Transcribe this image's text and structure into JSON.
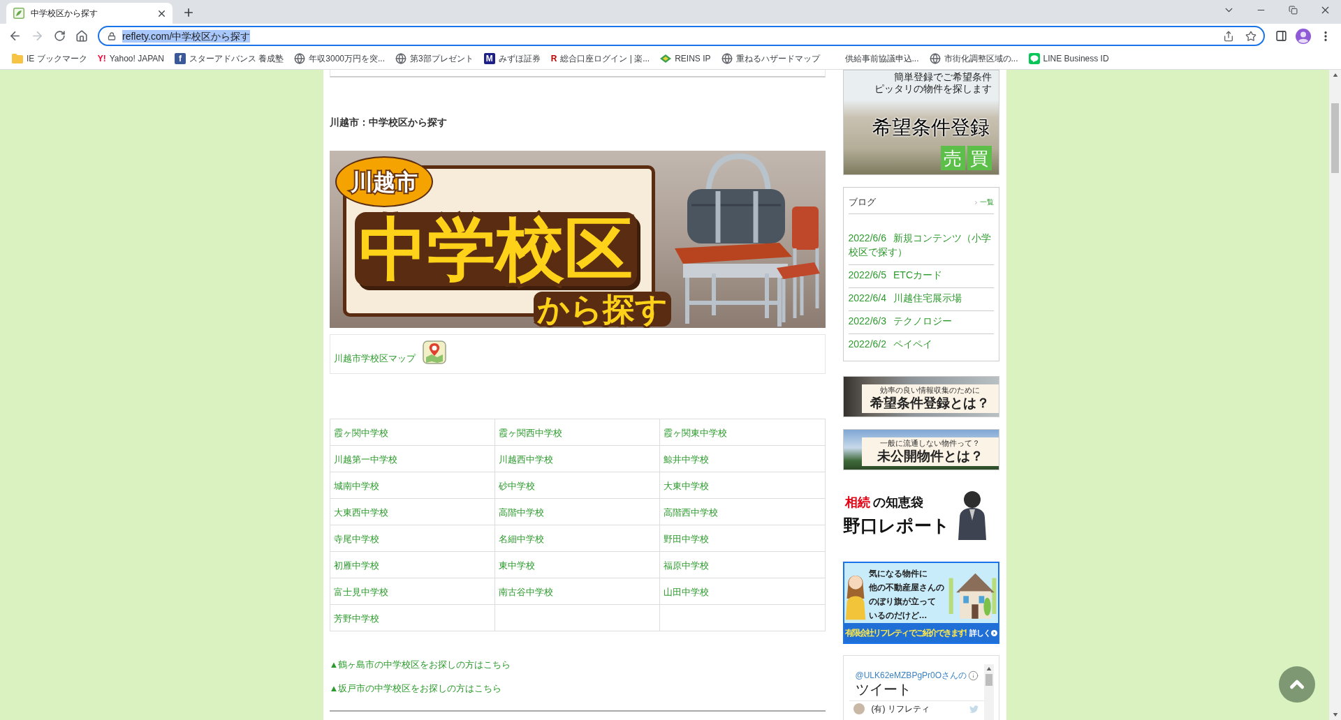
{
  "browser": {
    "tabs": [
      {
        "title": "中学校区から探す",
        "selected": true
      }
    ],
    "nav": {
      "back": {
        "disabled": false
      },
      "forward": {
        "disabled": true
      }
    },
    "address_bar": {
      "url": "reflety.com/中学校区から探す",
      "focused": true,
      "text_selected": true
    },
    "bookmarks": [
      {
        "label": "IE ブックマーク",
        "kind": "folder"
      },
      {
        "label": "Yahoo! JAPAN",
        "kind": "letter",
        "glyph": "Y!",
        "color": "#ff0033"
      },
      {
        "label": "スターアドバンス 養成塾",
        "kind": "tile",
        "glyph": "f",
        "color": "#3b5998"
      },
      {
        "label": "年収3000万円を突...",
        "kind": "globe"
      },
      {
        "label": "第3部プレゼント",
        "kind": "globe"
      },
      {
        "label": "みずほ証券",
        "kind": "tile",
        "glyph": "M",
        "color": "#1d2088"
      },
      {
        "label": "総合口座ログイン | 楽...",
        "kind": "letter",
        "glyph": "R",
        "color": "#bf0000"
      },
      {
        "label": "REINS IP",
        "kind": "diamond"
      },
      {
        "label": "重ねるハザードマップ",
        "kind": "globe"
      },
      {
        "label": "供給事前協議申込...",
        "kind": "blank"
      },
      {
        "label": "市街化調整区域の...",
        "kind": "globe"
      },
      {
        "label": "LINE Business ID",
        "kind": "chat"
      }
    ]
  },
  "page": {
    "heading": "川越市：中学校区から探す",
    "banner": {
      "city": "川越市",
      "title": "中学校区",
      "subtitle": "から探す"
    },
    "map_link": "川越市学校区マップ",
    "schools": [
      [
        "霞ヶ関中学校",
        "霞ヶ関西中学校",
        "霞ヶ関東中学校"
      ],
      [
        "川越第一中学校",
        "川越西中学校",
        "鯨井中学校"
      ],
      [
        "城南中学校",
        "砂中学校",
        "大東中学校"
      ],
      [
        "大東西中学校",
        "高階中学校",
        "高階西中学校"
      ],
      [
        "寺尾中学校",
        "名細中学校",
        "野田中学校"
      ],
      [
        "初雁中学校",
        "東中学校",
        "福原中学校"
      ],
      [
        "富士見中学校",
        "南古谷中学校",
        "山田中学校"
      ],
      [
        "芳野中学校"
      ]
    ],
    "links": [
      "▲鶴ヶ島市の中学校区をお探しの方はこちら",
      "▲坂戸市の中学校区をお探しの方はこちら"
    ]
  },
  "sidebar": {
    "register_banner": {
      "lines": [
        "簡単登録でご希望条件",
        "ピッタリの物件を探します"
      ],
      "title": "希望条件登録",
      "tags": [
        "売",
        "買"
      ]
    },
    "blog": {
      "title": "ブログ",
      "more": "一覧",
      "posts": [
        {
          "date": "2022/6/6",
          "title": "新規コンテンツ（小学校区で探す）"
        },
        {
          "date": "2022/6/5",
          "title": "ETCカード"
        },
        {
          "date": "2022/6/4",
          "title": "川越住宅展示場"
        },
        {
          "date": "2022/6/3",
          "title": "テクノロジー"
        },
        {
          "date": "2022/6/2",
          "title": "ペイペイ"
        }
      ]
    },
    "promos": [
      {
        "kind": "street",
        "caption": "効率の良い情報収集のために",
        "headline": "希望条件登録とは？"
      },
      {
        "kind": "meadow",
        "caption": "一般に流通しない物件って？",
        "headline": "未公開物件とは？"
      }
    ],
    "report_banner": {
      "highlight": "相続",
      "label": "の知恵袋",
      "title": "野口レポート"
    },
    "agent_banner": {
      "lines": [
        "気になる物件に",
        "他の不動産屋さんの",
        "のぼり旗が立って",
        "いるのだけど…"
      ],
      "footer": "有限会社リフレティ でご紹介できます!",
      "more": "詳しく"
    },
    "twitter": {
      "handle": "@ULK62eMZBPgPr0Oさんの",
      "title": "ツイート",
      "tweets": [
        {
          "author": "(有) リフレティ"
        }
      ]
    }
  }
}
